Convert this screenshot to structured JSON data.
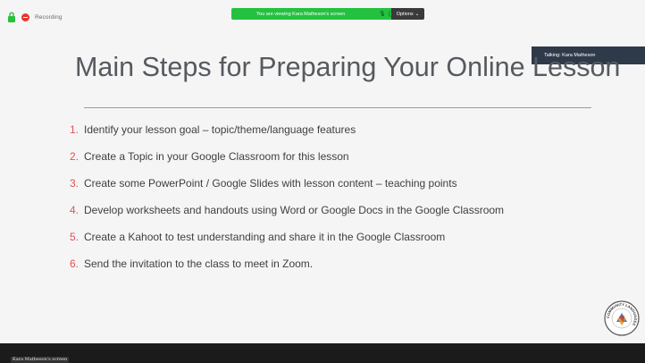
{
  "window": {
    "recording_label": "Recording"
  },
  "share_banner": {
    "message": "You are viewing Kara Matheson's screen",
    "options_label": "Options"
  },
  "talking_indicator": "Talking: Kara Matheson",
  "slide": {
    "title": "Main Steps for Preparing Your Online Lesson",
    "steps": [
      {
        "number": "1.",
        "text": "Identify your lesson goal – topic/theme/language features"
      },
      {
        "number": "2.",
        "text": "Create a Topic in your Google Classroom for this lesson"
      },
      {
        "number": "3.",
        "text": "Create some PowerPoint / Google Slides with lesson content – teaching points"
      },
      {
        "number": "4.",
        "text": "Develop worksheets and handouts using Word or Google Docs in the Google Classroom"
      },
      {
        "number": "5.",
        "text": "Create a Kahoot to test understanding and share it in the Google Classroom"
      },
      {
        "number": "6.",
        "text": "Send the invitation to the class to meet in Zoom."
      }
    ],
    "logo_text": "COMMUNITY LANGUAGES"
  },
  "bottom_bar": {
    "screen_label": "Kara Matheson's screen"
  },
  "colors": {
    "accent_green": "#23c13f",
    "number_red": "#e05252",
    "title_grey": "#555a5f",
    "talking_bg": "#2e3a4a"
  },
  "icons": [
    "lock-icon",
    "recording-icon",
    "mic-icon",
    "stop-icon",
    "chevron-down-icon",
    "community-languages-logo"
  ]
}
